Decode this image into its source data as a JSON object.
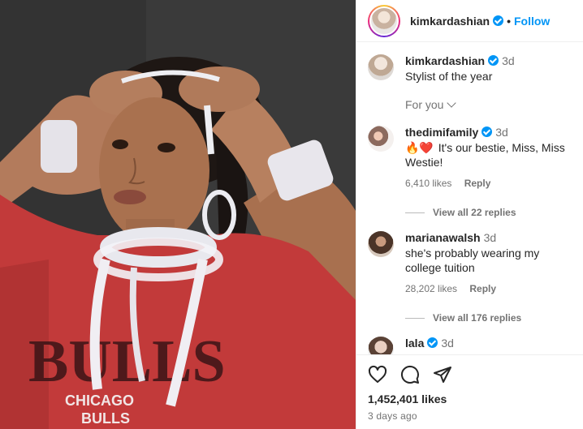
{
  "header": {
    "username": "kimkardashian",
    "separator": "•",
    "follow_label": "Follow"
  },
  "caption": {
    "username": "kimkardashian",
    "time": "3d",
    "text": "Stylist of the year",
    "for_you_label": "For you"
  },
  "comments": [
    {
      "username": "thedimifamily",
      "time": "3d",
      "emojis": "🔥❤️",
      "text": "It's our bestie, Miss, Miss Westie!",
      "likes": "6,410 likes",
      "reply_label": "Reply",
      "view_replies": "View all 22 replies"
    },
    {
      "username": "marianawalsh",
      "time": "3d",
      "text": "she's probably wearing my college tuition",
      "likes": "28,202 likes",
      "reply_label": "Reply",
      "view_replies": "View all 176 replies"
    },
    {
      "username": "lala",
      "time": "3d"
    }
  ],
  "footer": {
    "likes": "1,452,401 likes",
    "date": "3 days ago"
  },
  "photo": {
    "shirt_text_1": "BULLS",
    "shirt_text_2": "CHICAGO",
    "shirt_text_3": "BULLS"
  },
  "icons": [
    "heart-icon",
    "comment-icon",
    "share-icon",
    "chevron-down-icon",
    "verified-icon"
  ],
  "colors": {
    "accent": "#0095f6",
    "shirt": "#c23a3a",
    "text_secondary": "#737373"
  }
}
